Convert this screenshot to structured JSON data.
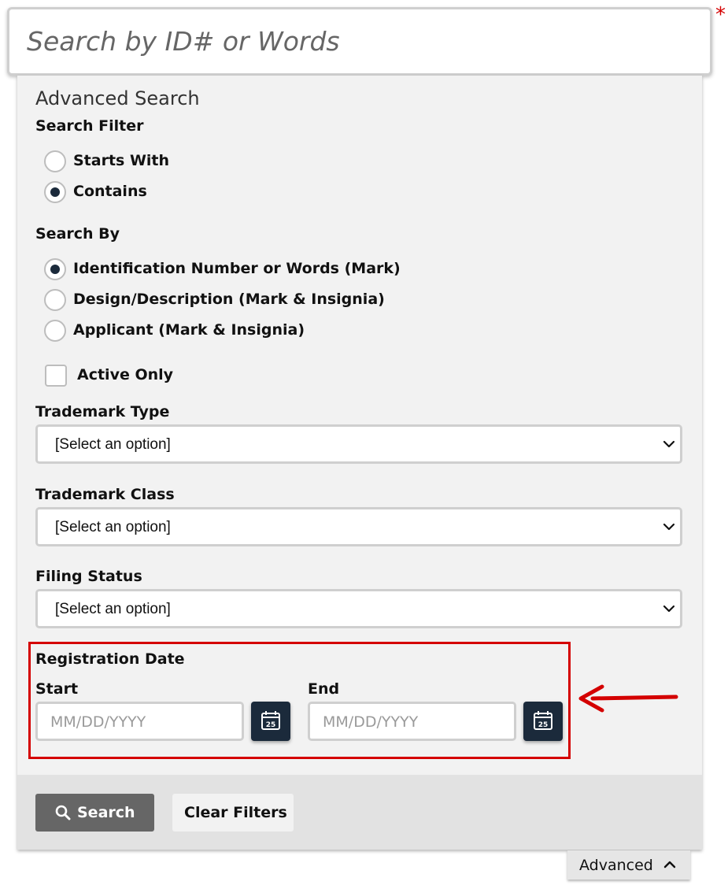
{
  "search": {
    "placeholder": "Search by ID# or Words",
    "required_marker": "*"
  },
  "advanced": {
    "title": "Advanced Search",
    "search_filter": {
      "label": "Search Filter",
      "options": [
        {
          "label": "Starts With",
          "checked": false
        },
        {
          "label": "Contains",
          "checked": true
        }
      ]
    },
    "search_by": {
      "label": "Search By",
      "options": [
        {
          "label": "Identification Number or Words (Mark)",
          "checked": true
        },
        {
          "label": "Design/Description (Mark & Insignia)",
          "checked": false
        },
        {
          "label": "Applicant (Mark & Insignia)",
          "checked": false
        }
      ]
    },
    "active_only": {
      "label": "Active Only",
      "checked": false
    },
    "trademark_type": {
      "label": "Trademark Type",
      "value": "[Select an option]"
    },
    "trademark_class": {
      "label": "Trademark Class",
      "value": "[Select an option]"
    },
    "filing_status": {
      "label": "Filing Status",
      "value": "[Select an option]"
    },
    "registration_date": {
      "label": "Registration Date",
      "start_label": "Start",
      "end_label": "End",
      "start_placeholder": "MM/DD/YYYY",
      "end_placeholder": "MM/DD/YYYY",
      "calendar_day": "25"
    }
  },
  "footer": {
    "search_label": "Search",
    "clear_label": "Clear Filters",
    "advanced_toggle_label": "Advanced"
  },
  "colors": {
    "accent_dark": "#1b2a3b",
    "highlight": "#d40000",
    "search_button": "#666666"
  },
  "icons": {
    "search_button_icon": "magnifier-icon",
    "calendar_icon": "calendar-icon",
    "toggle_icon": "chevron-up-icon",
    "annotation": "arrow-left-icon"
  }
}
